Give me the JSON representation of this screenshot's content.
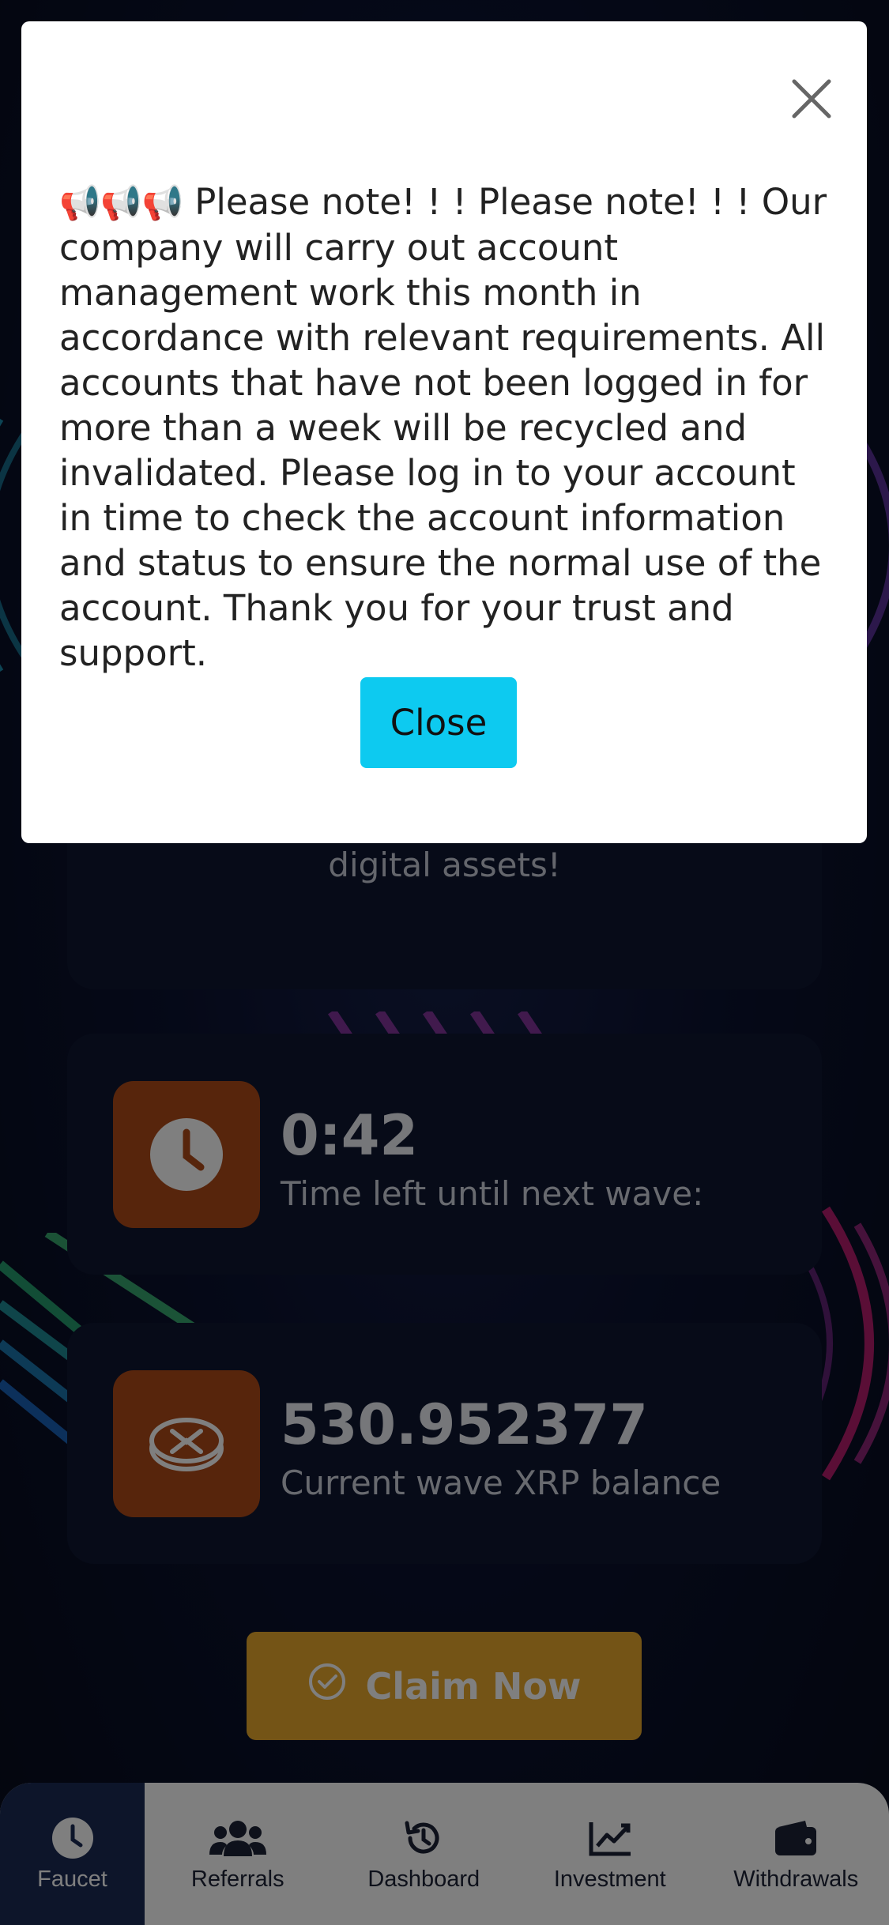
{
  "info_card": {
    "text": "digital assets!"
  },
  "timer": {
    "value": "0:42",
    "label": "Time left until next wave:",
    "icon": "clock-icon"
  },
  "balance": {
    "value": "530.952377",
    "label": "Current wave XRP balance",
    "icon": "xrp-coin-icon"
  },
  "claim_button": {
    "label": "Claim Now",
    "icon": "check-circle-icon"
  },
  "bottom_nav": {
    "items": [
      {
        "label": "Faucet",
        "icon": "faucet-clock-icon",
        "active": true
      },
      {
        "label": "Referrals",
        "icon": "users-icon",
        "active": false
      },
      {
        "label": "Dashboard",
        "icon": "history-icon",
        "active": false
      },
      {
        "label": "Investment",
        "icon": "chart-line-icon",
        "active": false
      },
      {
        "label": "Withdrawals",
        "icon": "wallet-icon",
        "active": false
      }
    ]
  },
  "modal": {
    "megaphones": "📢📢📢",
    "message": "Please note! ! ! Please note! ! ! Our company will carry out account management work this month in accordance with relevant requirements. All accounts that have not been logged in for more than a week will be recycled and invalidated. Please log in to your account in time to check the account information and status to ensure the normal use of the account. Thank you for your trust and support.",
    "close_label": "Close"
  },
  "colors": {
    "accent_orange": "#ae4a18",
    "claim_yellow": "#e8a92d",
    "close_button_cyan": "#0dcaf0",
    "nav_active": "#1a2a55"
  }
}
